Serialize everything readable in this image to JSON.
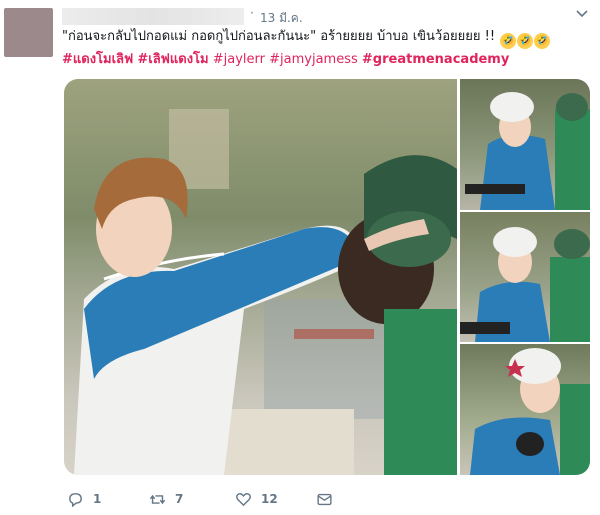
{
  "tweet": {
    "date": "13 มี.ค.",
    "separator": "·",
    "quote_text": "\"ก่อนจะกลับไปกอดแม่ กอดกูไปก่อนละกันนะ\"",
    "reaction_text": " อร้ายยยย บ้าบอ เขินว้อยยยย !!",
    "emojis": [
      "🤣",
      "🤣",
      "🤣"
    ],
    "hashtags": [
      "#แดงโมเลิฟ",
      "#เลิฟแดงโม",
      "#jaylerr",
      "#jamyjamess",
      "#greatmenacademy"
    ]
  },
  "actions": {
    "reply_count": "1",
    "retweet_count": "7",
    "like_count": "12"
  },
  "icons": [
    "chevron-down-icon",
    "reply-icon",
    "retweet-icon",
    "like-icon",
    "message-icon"
  ],
  "colors": {
    "hashtag": "#e0245e",
    "meta_gray": "#657786"
  }
}
